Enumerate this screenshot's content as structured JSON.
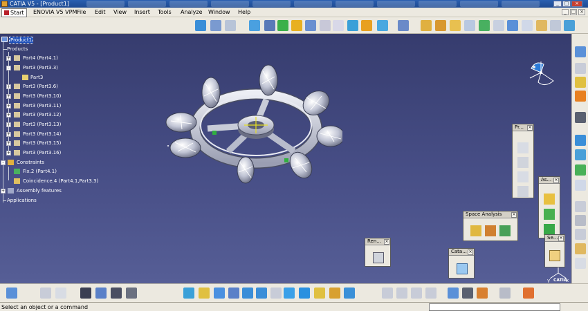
{
  "window": {
    "title": "CATIA V5 - [Product1]",
    "min": "_",
    "max": "□",
    "close": "×"
  },
  "menu": {
    "start": "Start",
    "items": [
      "ENOVIA V5 VPM",
      "File",
      "Edit",
      "View",
      "Insert",
      "Tools",
      "Analyze",
      "Window",
      "Help"
    ]
  },
  "tree": {
    "root": "Product1",
    "products": "Products",
    "parts": [
      "Part4 (Part4.1)",
      "Part3 (Part3.3)",
      "Part3",
      "Part3 (Part3.6)",
      "Part3 (Part3.10)",
      "Part3 (Part3.11)",
      "Part3 (Part3.12)",
      "Part3 (Part3.13)",
      "Part3 (Part3.14)",
      "Part3 (Part3.15)",
      "Part3 (Part3.16)"
    ],
    "constraints": "Constraints",
    "constraint_items": [
      "Fix.2 (Part4.1)",
      "Coincidence.4 (Part4.1,Part3.3)"
    ],
    "assembly_features": "Assembly features",
    "applications": "Applications"
  },
  "panels": {
    "space_analysis": "Space Analysis",
    "render": "Ren...",
    "catalog": "Cata...",
    "product": "Pr...",
    "assembly": "As...",
    "select": "Se..."
  },
  "status": {
    "message": "Select an object or a command"
  },
  "compass": {
    "x": "x",
    "y": "y",
    "z": "z"
  },
  "brand": "CATIA",
  "colors": {
    "viewport_top": "#363c6e",
    "viewport_bottom": "#565e96",
    "selection": "#1e4fb8",
    "toolbar": "#ece9e0"
  }
}
